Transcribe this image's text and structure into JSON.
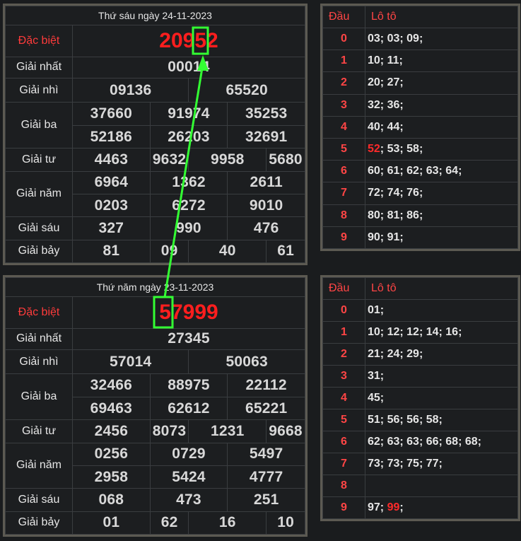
{
  "results": [
    {
      "title": "Thứ sáu ngày 24-11-2023",
      "labels": {
        "special": "Đặc biệt",
        "first": "Giải nhất",
        "second": "Giải nhì",
        "third": "Giải ba",
        "fourth": "Giải tư",
        "fifth": "Giải năm",
        "sixth": "Giải sáu",
        "seventh": "Giải bảy"
      },
      "special": "20952",
      "first": "00014",
      "second": [
        "09136",
        "65520"
      ],
      "third": [
        "37660",
        "91974",
        "35253",
        "52186",
        "26203",
        "32691"
      ],
      "fourth": [
        "4463",
        "9632",
        "9958",
        "5680"
      ],
      "fifth": [
        "6964",
        "1362",
        "2611",
        "0203",
        "6272",
        "9010"
      ],
      "sixth": [
        "327",
        "990",
        "476"
      ],
      "seventh": [
        "81",
        "09",
        "40",
        "61"
      ]
    },
    {
      "title": "Thứ năm ngày 23-11-2023",
      "labels": {
        "special": "Đặc biệt",
        "first": "Giải nhất",
        "second": "Giải nhì",
        "third": "Giải ba",
        "fourth": "Giải tư",
        "fifth": "Giải năm",
        "sixth": "Giải sáu",
        "seventh": "Giải bảy"
      },
      "special": "57999",
      "first": "27345",
      "second": [
        "57014",
        "50063"
      ],
      "third": [
        "32466",
        "88975",
        "22112",
        "69463",
        "62612",
        "65221"
      ],
      "fourth": [
        "2456",
        "8073",
        "1231",
        "9668"
      ],
      "fifth": [
        "0256",
        "0729",
        "5497",
        "2958",
        "5424",
        "4777"
      ],
      "sixth": [
        "068",
        "473",
        "251"
      ],
      "seventh": [
        "01",
        "62",
        "16",
        "10"
      ]
    }
  ],
  "loto": [
    {
      "header": {
        "dau": "Đầu",
        "loto": "Lô tô"
      },
      "rows": [
        {
          "dau": "0",
          "pre": "03; 03; 09;",
          "hl": "",
          "post": ""
        },
        {
          "dau": "1",
          "pre": "10; 11;",
          "hl": "",
          "post": ""
        },
        {
          "dau": "2",
          "pre": "20; 27;",
          "hl": "",
          "post": ""
        },
        {
          "dau": "3",
          "pre": "32; 36;",
          "hl": "",
          "post": ""
        },
        {
          "dau": "4",
          "pre": "40; 44;",
          "hl": "",
          "post": ""
        },
        {
          "dau": "5",
          "pre": "",
          "hl": "52",
          "post": "; 53; 58;"
        },
        {
          "dau": "6",
          "pre": "60; 61; 62; 63; 64;",
          "hl": "",
          "post": ""
        },
        {
          "dau": "7",
          "pre": "72; 74; 76;",
          "hl": "",
          "post": ""
        },
        {
          "dau": "8",
          "pre": "80; 81; 86;",
          "hl": "",
          "post": ""
        },
        {
          "dau": "9",
          "pre": "90; 91;",
          "hl": "",
          "post": ""
        }
      ]
    },
    {
      "header": {
        "dau": "Đầu",
        "loto": "Lô tô"
      },
      "rows": [
        {
          "dau": "0",
          "pre": "01;",
          "hl": "",
          "post": ""
        },
        {
          "dau": "1",
          "pre": "10; 12; 12; 14; 16;",
          "hl": "",
          "post": ""
        },
        {
          "dau": "2",
          "pre": "21; 24; 29;",
          "hl": "",
          "post": ""
        },
        {
          "dau": "3",
          "pre": "31;",
          "hl": "",
          "post": ""
        },
        {
          "dau": "4",
          "pre": "45;",
          "hl": "",
          "post": ""
        },
        {
          "dau": "5",
          "pre": "51; 56; 56; 58;",
          "hl": "",
          "post": ""
        },
        {
          "dau": "6",
          "pre": "62; 63; 63; 66; 68; 68;",
          "hl": "",
          "post": ""
        },
        {
          "dau": "7",
          "pre": "73; 73; 75; 77;",
          "hl": "",
          "post": ""
        },
        {
          "dau": "8",
          "pre": "",
          "hl": "",
          "post": ""
        },
        {
          "dau": "9",
          "pre": "97; ",
          "hl": "99",
          "post": ";"
        }
      ]
    }
  ],
  "colors": {
    "accent_red": "#ff1e1e",
    "annotation_green": "#33ff33",
    "border": "#5c5a52"
  }
}
